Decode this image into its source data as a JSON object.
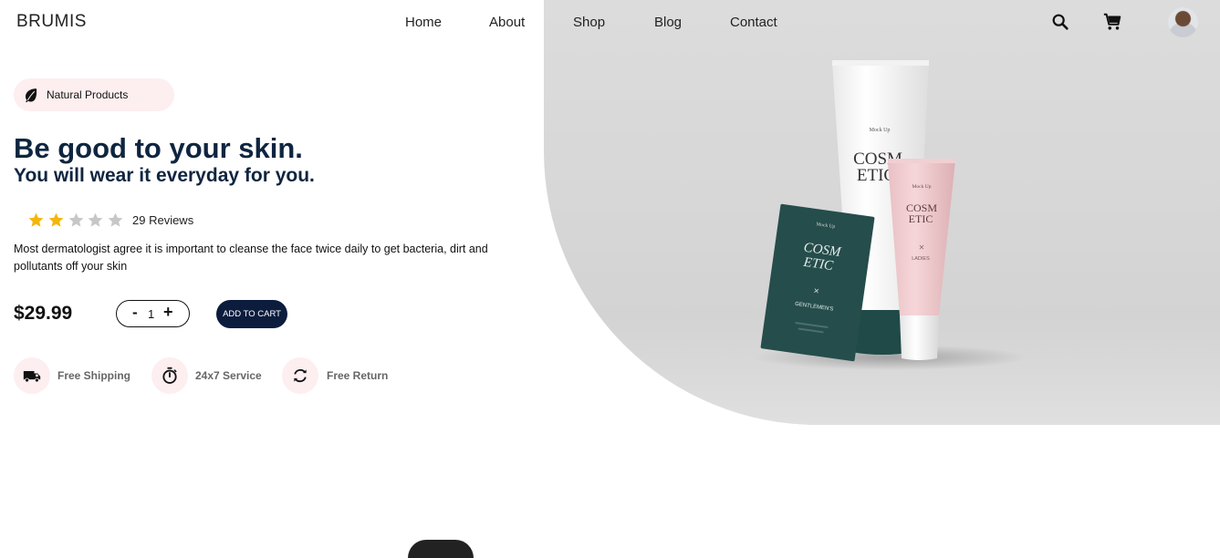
{
  "header": {
    "logo": "BRUMIS",
    "nav": [
      {
        "label": "Home"
      },
      {
        "label": "About"
      },
      {
        "label": "Shop"
      },
      {
        "label": "Blog"
      },
      {
        "label": "Contact"
      }
    ],
    "icons": [
      "search-icon",
      "cart-icon",
      "avatar"
    ]
  },
  "hero": {
    "badge": "Natural Products",
    "title": "Be good to your skin.",
    "subtitle": "You will wear it everyday for you.",
    "rating": {
      "filled": 2,
      "total": 5,
      "reviews_label": "29 Reviews"
    },
    "description": "Most dermatologist agree it is important to cleanse the face twice daily to get bacteria, dirt and pollutants off your skin",
    "price": "$29.99",
    "quantity": {
      "minus": "-",
      "value": "1",
      "plus": "+"
    },
    "add_to_cart": "ADD TO CART",
    "features": [
      {
        "label": "Free Shipping",
        "icon": "truck-icon"
      },
      {
        "label": "24x7 Service",
        "icon": "stopwatch-icon"
      },
      {
        "label": "Free Return",
        "icon": "return-icon"
      }
    ]
  },
  "product_image": {
    "tube_large": {
      "brand": "Mock Up",
      "text1": "COSM",
      "text2": "ETIC"
    },
    "sachet": {
      "brand": "Mock Up",
      "text1": "COSM",
      "text2": "ETIC",
      "label": "GENTLEMEN'S"
    },
    "tube_small": {
      "brand": "Mock Up",
      "text1": "COSM",
      "text2": "ETIC",
      "label": "LADIES"
    }
  },
  "colors": {
    "navy": "#0b1c3d",
    "heading": "#0f2540",
    "pink_bg": "#fdeef0",
    "star_filled": "#f5b50a",
    "star_empty": "#c7c7c7",
    "hero_bg": "#d8d8d8"
  }
}
